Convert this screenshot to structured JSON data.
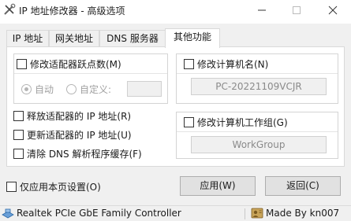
{
  "window": {
    "title": "IP 地址修改器 - 高级选项"
  },
  "tabs": [
    {
      "label": "IP 地址"
    },
    {
      "label": "网关地址"
    },
    {
      "label": "DNS 服务器"
    },
    {
      "label": "其他功能"
    }
  ],
  "active_tab": "其他功能",
  "adapter_hops": {
    "label": "修改适配器跃点数(M)",
    "auto_label": "自动",
    "custom_label": "自定义:",
    "custom_value": "",
    "selected": "自动"
  },
  "computer_name": {
    "label": "修改计算机名(N)",
    "value": "PC-20221109VCJR"
  },
  "workgroup": {
    "label": "修改计算机工作组(G)",
    "value": "WorkGroup"
  },
  "options": [
    {
      "label": "释放适配器的 IP 地址(R)"
    },
    {
      "label": "更新适配器的 IP 地址(U)"
    },
    {
      "label": "清除 DNS 解析程序缓存(F)"
    }
  ],
  "bottom": {
    "current_page_only_label": "仅应用本页设置(O)",
    "apply_label": "应用(W)",
    "back_label": "返回(C)"
  },
  "status": {
    "adapter": "Realtek PCIe GbE Family Controller",
    "credit": "Made By kn007"
  }
}
